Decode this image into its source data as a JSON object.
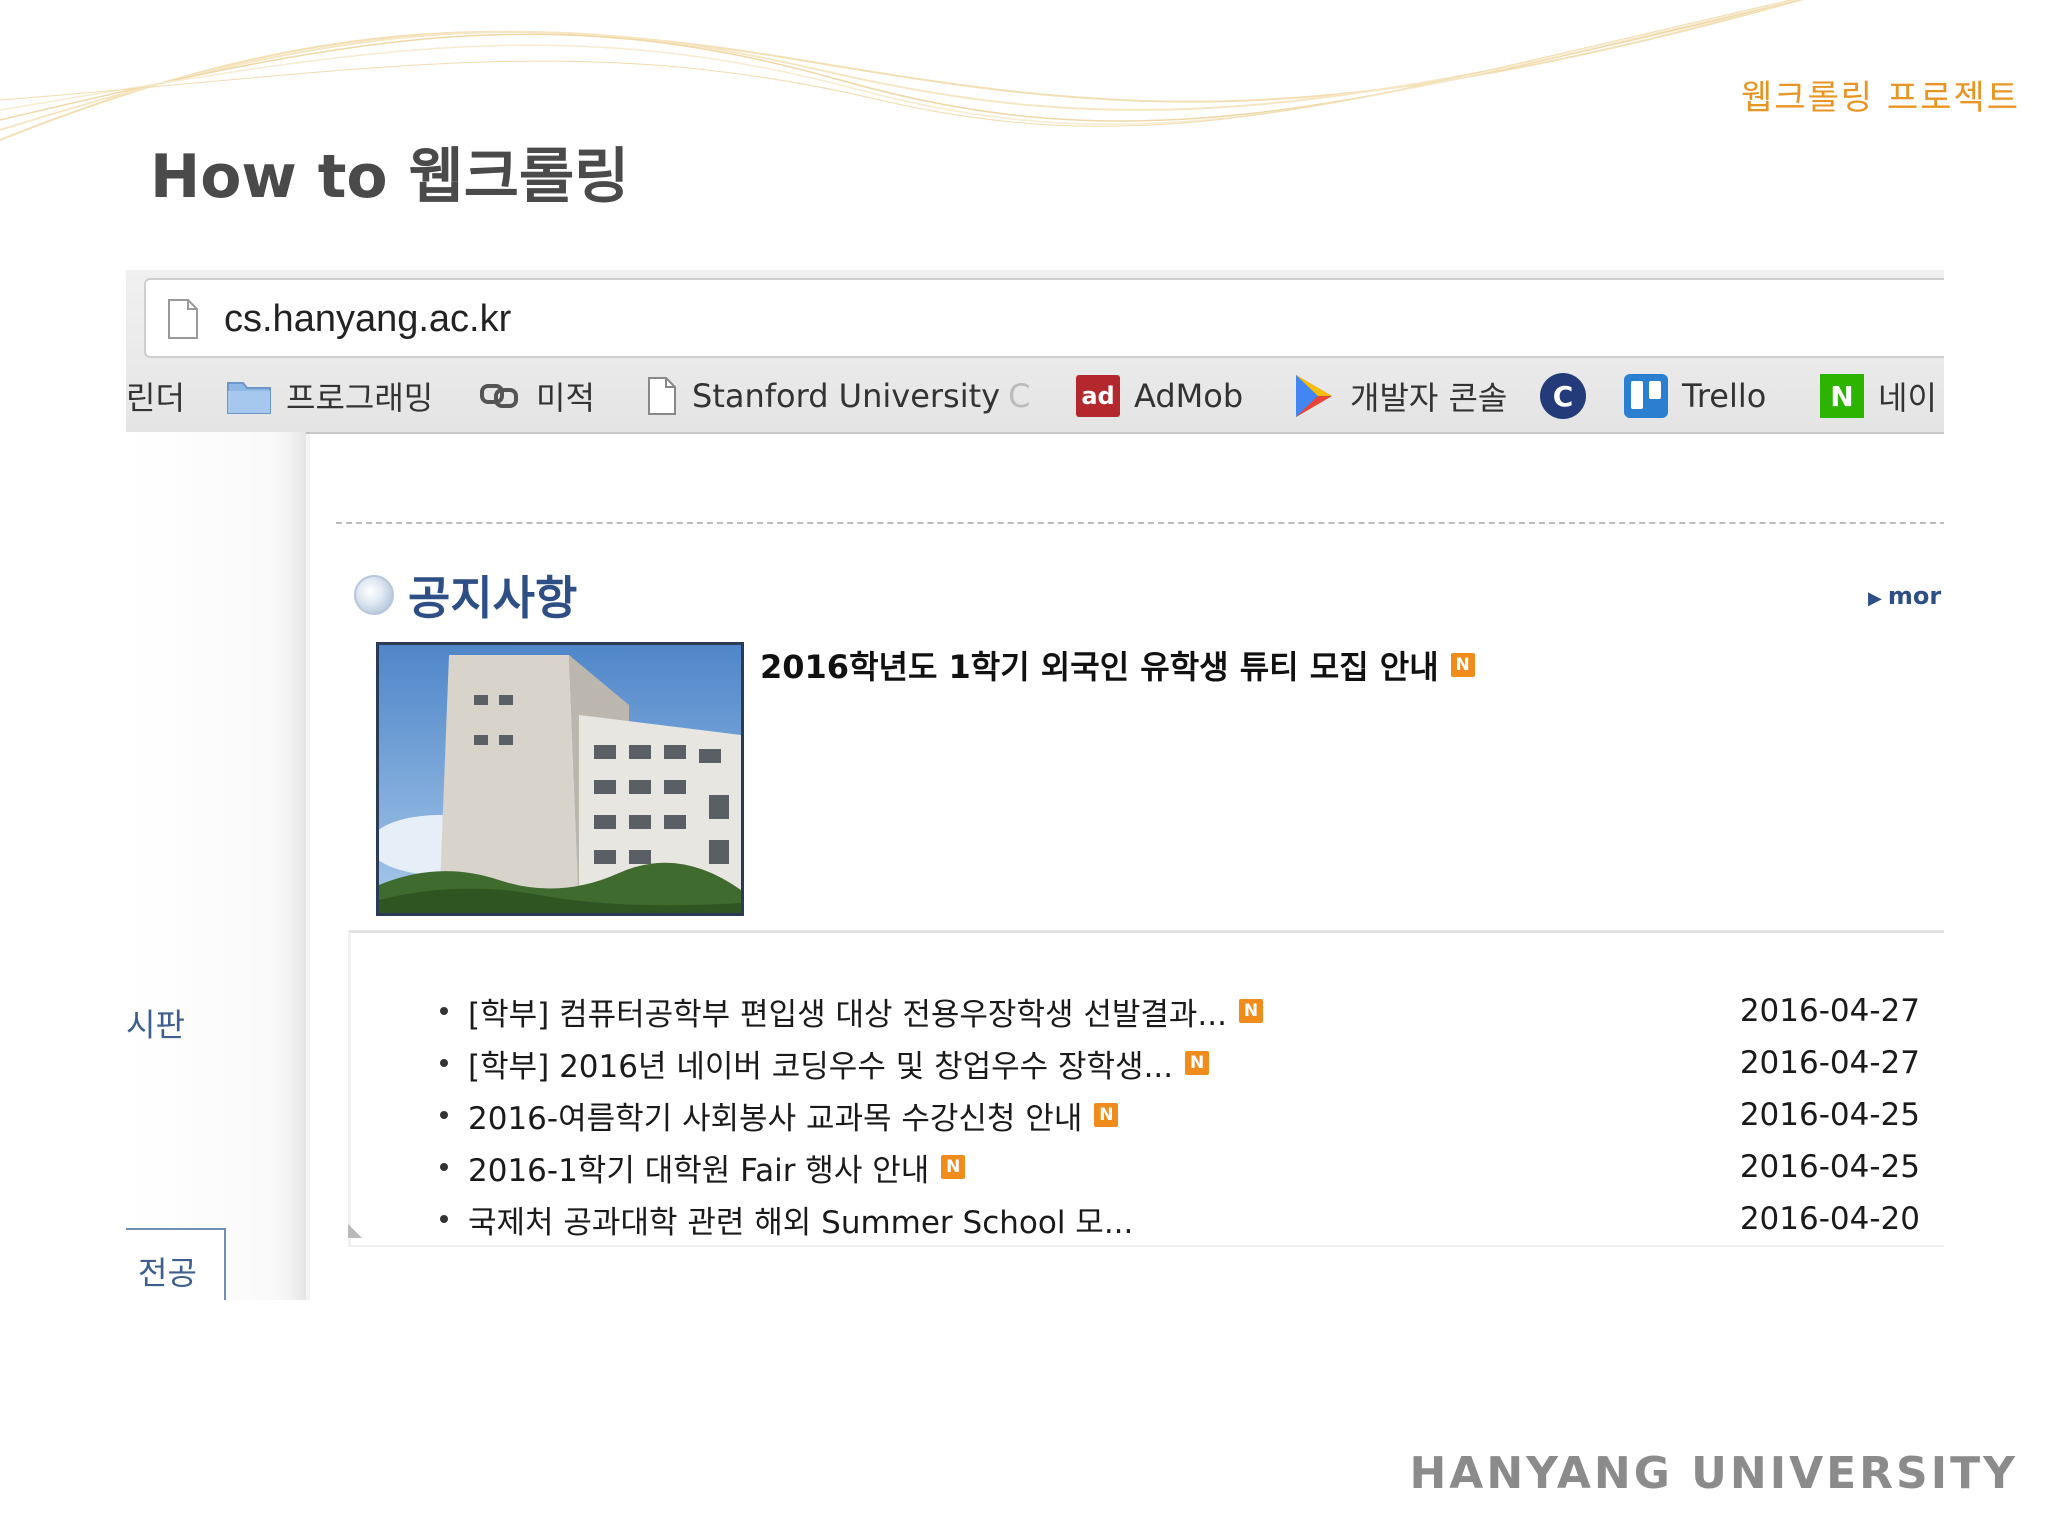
{
  "slide": {
    "deck_title": "웹크롤링 프로젝트",
    "title": "How to 웹크롤링",
    "footer_brand": "HANYANG UNIVERSITY"
  },
  "browser": {
    "url": "cs.hanyang.ac.kr",
    "bookmarks": [
      {
        "label": "린더",
        "icon": "none"
      },
      {
        "label": "프로그래밍",
        "icon": "folder-icon"
      },
      {
        "label": "미적",
        "icon": "link-icon"
      },
      {
        "label": "Stanford University",
        "trail": "C",
        "icon": "page-icon"
      },
      {
        "label": "AdMob",
        "icon": "admob-icon",
        "icon_text": "ad"
      },
      {
        "label": "개발자 콘솔",
        "icon": "play-icon"
      },
      {
        "label": "",
        "icon": "c-logo-icon",
        "icon_text": "C"
      },
      {
        "label": "Trello",
        "icon": "trello-icon"
      },
      {
        "label": "네이",
        "icon": "naver-icon",
        "icon_text": "N"
      }
    ]
  },
  "page": {
    "side_board_label": "시판",
    "side_tab_label": "전공",
    "notice": {
      "heading": "공지사항",
      "more_label": "mor",
      "featured_title": "2016학년도 1학기 외국인 유학생 튜티 모집 안내",
      "new_badge": "N",
      "items": [
        {
          "title": "[학부] 컴퓨터공학부 편입생 대상 전용우장학생 선발결과...",
          "date": "2016-04-27",
          "is_new": true
        },
        {
          "title": "[학부] 2016년 네이버 코딩우수 및 창업우수 장학생...",
          "date": "2016-04-27",
          "is_new": true
        },
        {
          "title": "2016-여름학기 사회봉사 교과목 수강신청 안내",
          "date": "2016-04-25",
          "is_new": true
        },
        {
          "title": "2016-1학기 대학원 Fair 행사 안내",
          "date": "2016-04-25",
          "is_new": true
        },
        {
          "title": "국제처 공과대학 관련 해외 Summer School 모...",
          "date": "2016-04-20",
          "is_new": false
        }
      ]
    }
  },
  "colors": {
    "accent_orange": "#e99524",
    "notice_blue": "#2d4f86",
    "new_badge": "#f08c1b"
  }
}
